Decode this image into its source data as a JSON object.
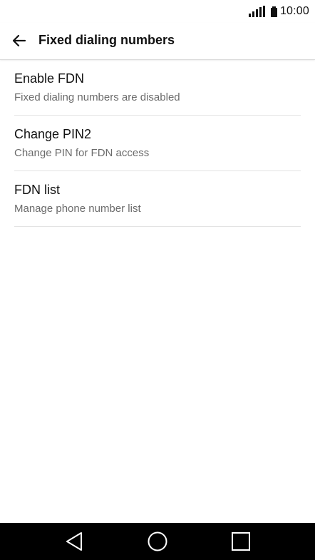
{
  "status_bar": {
    "time": "10:00",
    "icons": [
      "signal-icon",
      "battery-icon"
    ]
  },
  "app_bar": {
    "title": "Fixed dialing numbers",
    "back_icon": "arrow-left-icon"
  },
  "settings": [
    {
      "title": "Enable FDN",
      "summary": "Fixed dialing numbers are disabled"
    },
    {
      "title": "Change PIN2",
      "summary": "Change PIN for FDN access"
    },
    {
      "title": "FDN list",
      "summary": "Manage phone number list"
    }
  ],
  "nav_bar": {
    "icons": [
      "back-triangle-icon",
      "home-circle-icon",
      "recents-square-icon"
    ]
  },
  "colors": {
    "background": "#ffffff",
    "text_primary": "#111111",
    "text_secondary": "#6b6b6b",
    "divider": "#e3e3e3",
    "nav_bar": "#000000"
  }
}
